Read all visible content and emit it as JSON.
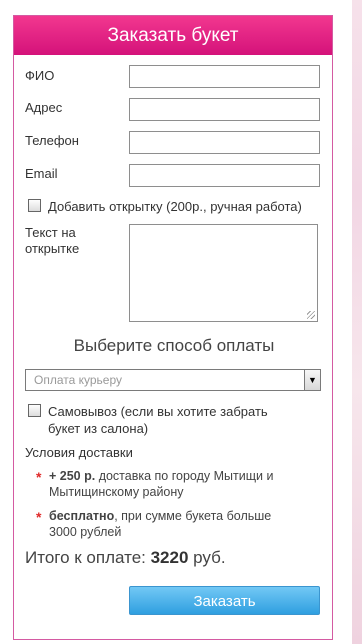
{
  "header": {
    "title": "Заказать букет"
  },
  "fields": [
    {
      "label": "ФИО",
      "value": ""
    },
    {
      "label": "Адрес",
      "value": ""
    },
    {
      "label": "Телефон",
      "value": ""
    },
    {
      "label": "Email",
      "value": ""
    }
  ],
  "add_card": {
    "label": "Добавить открытку (200р., ручная работа)",
    "checked": false
  },
  "card_text": {
    "label_line1": "Текст на",
    "label_line2": "открытке",
    "value": ""
  },
  "payment": {
    "title": "Выберите способ оплаты",
    "selected": "Оплата курьеру"
  },
  "pickup": {
    "label_line1": "Самовывоз (если вы хотите забрать",
    "label_line2": "букет из салона)",
    "checked": false
  },
  "delivery": {
    "title": "Условия доставки",
    "items": [
      {
        "bold": "+ 250 р.",
        "text_line1": " доставка по городу Мытищи и",
        "text_line2": "Мытищинскому району"
      },
      {
        "bold": "бесплатно",
        "text_line1": ", при сумме букета больше",
        "text_line2": "3000 рублей"
      }
    ]
  },
  "total": {
    "label": "Итого к оплате: ",
    "amount": "3220",
    "currency": " руб."
  },
  "submit_label": "Заказать",
  "colors": {
    "header": "#e0207f",
    "border": "#d45aa2",
    "button": "#2f9fe0"
  }
}
